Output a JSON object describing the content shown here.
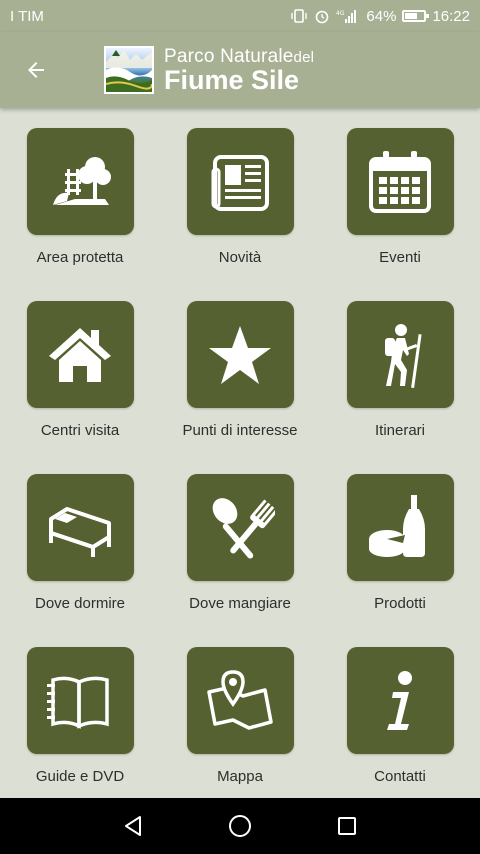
{
  "status_bar": {
    "carrier": "I TIM",
    "battery": "64%",
    "time": "16:22",
    "network": "4G"
  },
  "header": {
    "back_icon": "arrow-left-icon",
    "brand_line1": "Parco Naturale",
    "brand_line1_small": "del",
    "brand_line2": "Fiume Sile"
  },
  "grid": {
    "items": [
      {
        "label": "Area protetta",
        "icon": "protected-area-icon"
      },
      {
        "label": "Novità",
        "icon": "newspaper-icon"
      },
      {
        "label": "Eventi",
        "icon": "calendar-icon"
      },
      {
        "label": "Centri visita",
        "icon": "home-icon"
      },
      {
        "label": "Punti di interesse",
        "icon": "star-icon"
      },
      {
        "label": "Itinerari",
        "icon": "hiker-icon"
      },
      {
        "label": "Dove dormire",
        "icon": "bed-icon"
      },
      {
        "label": "Dove mangiare",
        "icon": "fork-spoon-icon"
      },
      {
        "label": "Prodotti",
        "icon": "cheese-wine-icon"
      },
      {
        "label": "Guide e DVD",
        "icon": "book-icon"
      },
      {
        "label": "Mappa",
        "icon": "map-pin-icon"
      },
      {
        "label": "Contatti",
        "icon": "info-icon"
      }
    ]
  },
  "nav_bar": {
    "back": "triangle-back-icon",
    "home": "circle-home-icon",
    "recents": "square-recents-icon"
  },
  "colors": {
    "header_bg": "#a8b094",
    "page_bg": "#dcdfd3",
    "tile_bg": "#556130",
    "label_text": "#2e2e2e"
  }
}
